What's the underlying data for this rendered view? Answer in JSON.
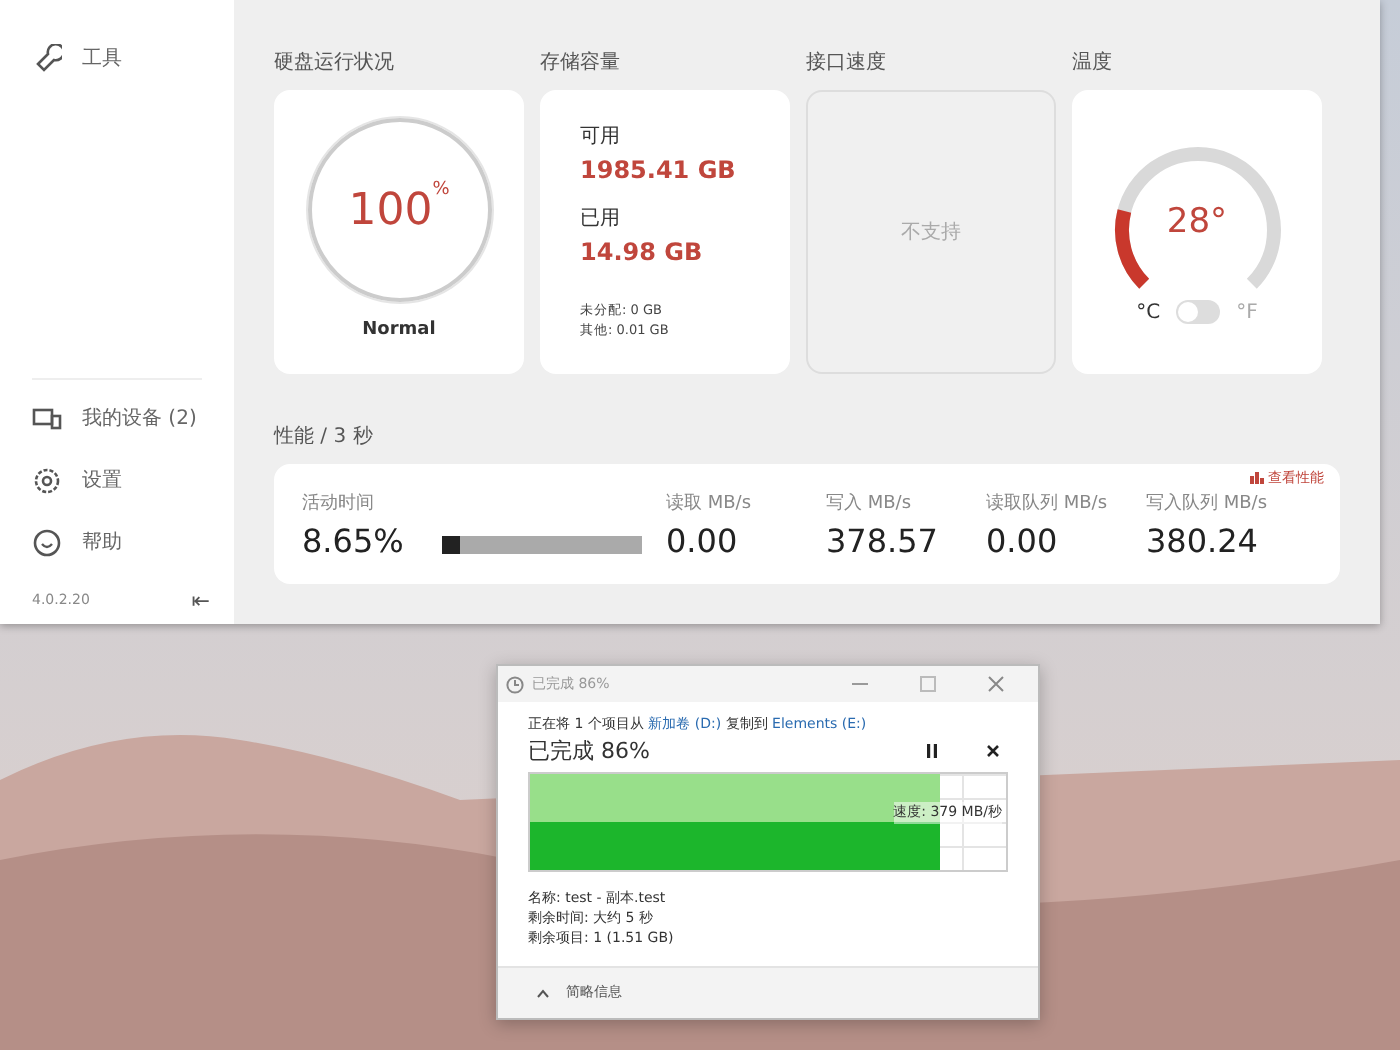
{
  "sidebar": {
    "items": [
      {
        "kind": "tools",
        "label": "工具"
      }
    ],
    "bottom_items": [
      {
        "kind": "devices",
        "label": "我的设备 (2)"
      },
      {
        "kind": "settings",
        "label": "设置"
      },
      {
        "kind": "help",
        "label": "帮助"
      }
    ],
    "version": "4.0.2.20",
    "collapse": "⇤"
  },
  "cards": {
    "health": {
      "title": "硬盘运行状况",
      "value": "100",
      "unit": "%",
      "status": "Normal"
    },
    "storage": {
      "title": "存储容量",
      "available_label": "可用",
      "available": "1985.41 GB",
      "used_label": "已用",
      "used": "14.98 GB",
      "unallocated": "未分配: 0 GB",
      "other": "其他: 0.01 GB"
    },
    "interface": {
      "title": "接口速度",
      "value": "不支持"
    },
    "temperature": {
      "title": "温度",
      "value": "28°",
      "unit_c": "°C",
      "unit_f": "°F",
      "fahrenheit": false
    }
  },
  "performance": {
    "title": "性能 / 3 秒",
    "link": "查看性能",
    "activity": {
      "label": "活动时间",
      "value": "8.65%",
      "level": 0.0865
    },
    "metrics": [
      {
        "label": "读取 MB/s",
        "value": "0.00"
      },
      {
        "label": "写入 MB/s",
        "value": "378.57"
      },
      {
        "label": "读取队列 MB/s",
        "value": "0.00"
      },
      {
        "label": "写入队列 MB/s",
        "value": "380.24"
      }
    ]
  },
  "copy_dialog": {
    "title": "已完成 86%",
    "source_prefix": "正在将 1 个项目从 ",
    "source": "新加卷 (D:)",
    "middle": " 复制到 ",
    "destination": "Elements (E:)",
    "heading": "已完成 86%",
    "level": 0.86,
    "speed": "速度: 379 MB/秒",
    "details": [
      "名称: test - 副本.test",
      "剩余时间: 大约 5 秒",
      "剩余项目: 1 (1.51 GB)"
    ],
    "toggle": "简略信息"
  }
}
